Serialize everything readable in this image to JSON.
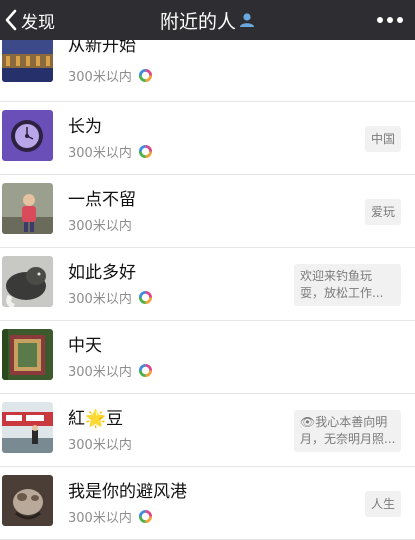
{
  "nav": {
    "back_label": "发现",
    "title": "附近的人"
  },
  "rows": [
    {
      "name": "从新开始",
      "distance": "300米以内",
      "signature": null
    },
    {
      "name": "长为",
      "distance": "300米以内",
      "signature": "中国"
    },
    {
      "name": "一点不留",
      "distance": "300米以内",
      "signature": "爱玩"
    },
    {
      "name": "如此多好",
      "distance": "300米以内",
      "signature_line1": "欢迎来钓鱼玩",
      "signature_line2": "耍，放松工作..."
    },
    {
      "name": "中天",
      "distance": "300米以内",
      "signature": null
    },
    {
      "name_prefix": "紅",
      "name_emoji": "🌟",
      "name_suffix": "豆",
      "distance": "300米以内",
      "signature_line1": "👁我心本善向明",
      "signature_line2": "月，无奈明月照..."
    },
    {
      "name": "我是你的避风港",
      "distance": "300米以内",
      "signature": "人生"
    }
  ],
  "icons": {
    "back": "chevron-left-icon",
    "title": "person-icon",
    "more": "more-dots-icon",
    "moments": "moments-ring-icon"
  }
}
